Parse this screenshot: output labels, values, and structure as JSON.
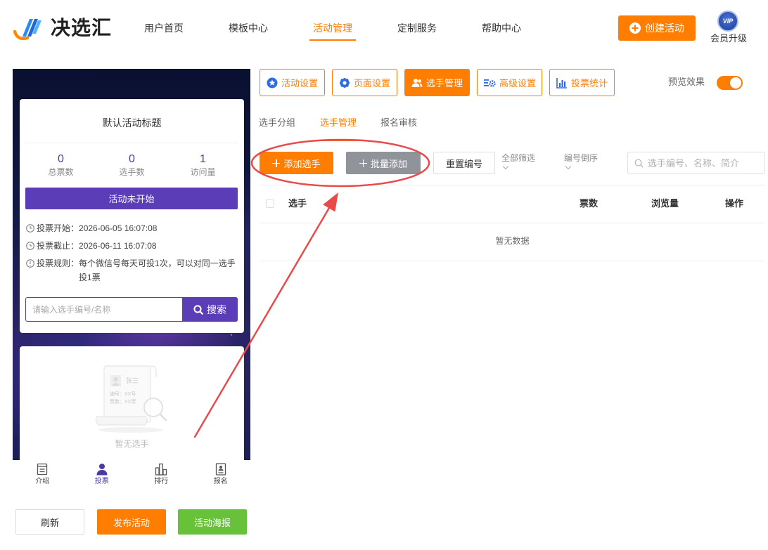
{
  "header": {
    "logo_text": "决选汇",
    "nav": [
      {
        "label": "用户首页",
        "active": false
      },
      {
        "label": "模板中心",
        "active": false
      },
      {
        "label": "活动管理",
        "active": true
      },
      {
        "label": "定制服务",
        "active": false
      },
      {
        "label": "帮助中心",
        "active": false
      }
    ],
    "create_button": {
      "label": "创建活动",
      "icon": "plus-circle-icon"
    },
    "vip_badge": "VIP",
    "member_upgrade": "会员升级"
  },
  "preview": {
    "activity_title": "默认活动标题",
    "stats": [
      {
        "value": "0",
        "label": "总票数"
      },
      {
        "value": "0",
        "label": "选手数"
      },
      {
        "value": "1",
        "label": "访问量"
      }
    ],
    "status_button": "活动未开始",
    "info": [
      {
        "icon": "clock-icon",
        "label": "投票开始：",
        "value": "2026-06-05 16:07:08"
      },
      {
        "icon": "clock-icon",
        "label": "投票截止：",
        "value": "2026-06-11 16:07:08"
      },
      {
        "icon": "info-icon",
        "label": "投票规则：",
        "value": "每个微信号每天可投1次，可以对同一选手投1票"
      }
    ],
    "search": {
      "placeholder": "请输入选手编号/名称",
      "button": "搜索",
      "icon": "search-icon"
    },
    "empty_state": {
      "sample_name": "张三",
      "sample_number": "编号：XX号",
      "sample_votes": "票数：XX票",
      "text": "暂无选手"
    },
    "tabbar": [
      {
        "label": "介绍",
        "icon": "document-icon",
        "active": false
      },
      {
        "label": "投票",
        "icon": "user-icon",
        "active": true
      },
      {
        "label": "排行",
        "icon": "bar-chart-icon",
        "active": false
      },
      {
        "label": "报名",
        "icon": "signup-form-icon",
        "active": false
      }
    ]
  },
  "bottom_actions": {
    "refresh": "刷新",
    "publish": "发布活动",
    "poster": "活动海报"
  },
  "settings_tabs": [
    {
      "label": "活动设置",
      "icon": "star-icon",
      "active": false
    },
    {
      "label": "页面设置",
      "icon": "gear-icon",
      "active": false
    },
    {
      "label": "选手管理",
      "icon": "users-icon",
      "active": true
    },
    {
      "label": "高级设置",
      "icon": "advanced-settings-icon",
      "active": false
    },
    {
      "label": "投票统计",
      "icon": "bar-chart-icon",
      "active": false
    }
  ],
  "preview_toggle": {
    "label": "预览效果",
    "on": true
  },
  "sub_tabs": [
    {
      "label": "选手分组",
      "active": false
    },
    {
      "label": "选手管理",
      "active": true
    },
    {
      "label": "报名审核",
      "active": false
    }
  ],
  "toolbar": {
    "add_contestant": "添加选手",
    "batch_add": "批量添加",
    "reset_numbers": "重置编号",
    "filter": "全部筛选",
    "sort": "编号倒序",
    "search_placeholder": "选手编号、名称、简介"
  },
  "table": {
    "columns": [
      "选手",
      "票数",
      "浏览量",
      "操作"
    ],
    "empty_text": "暂无数据"
  },
  "colors": {
    "accent": "#ff7d00",
    "purple": "#5b3db8",
    "green": "#67c23a",
    "gray": "#909399",
    "blue": "#2e6be6",
    "red": "#e94a4a"
  }
}
